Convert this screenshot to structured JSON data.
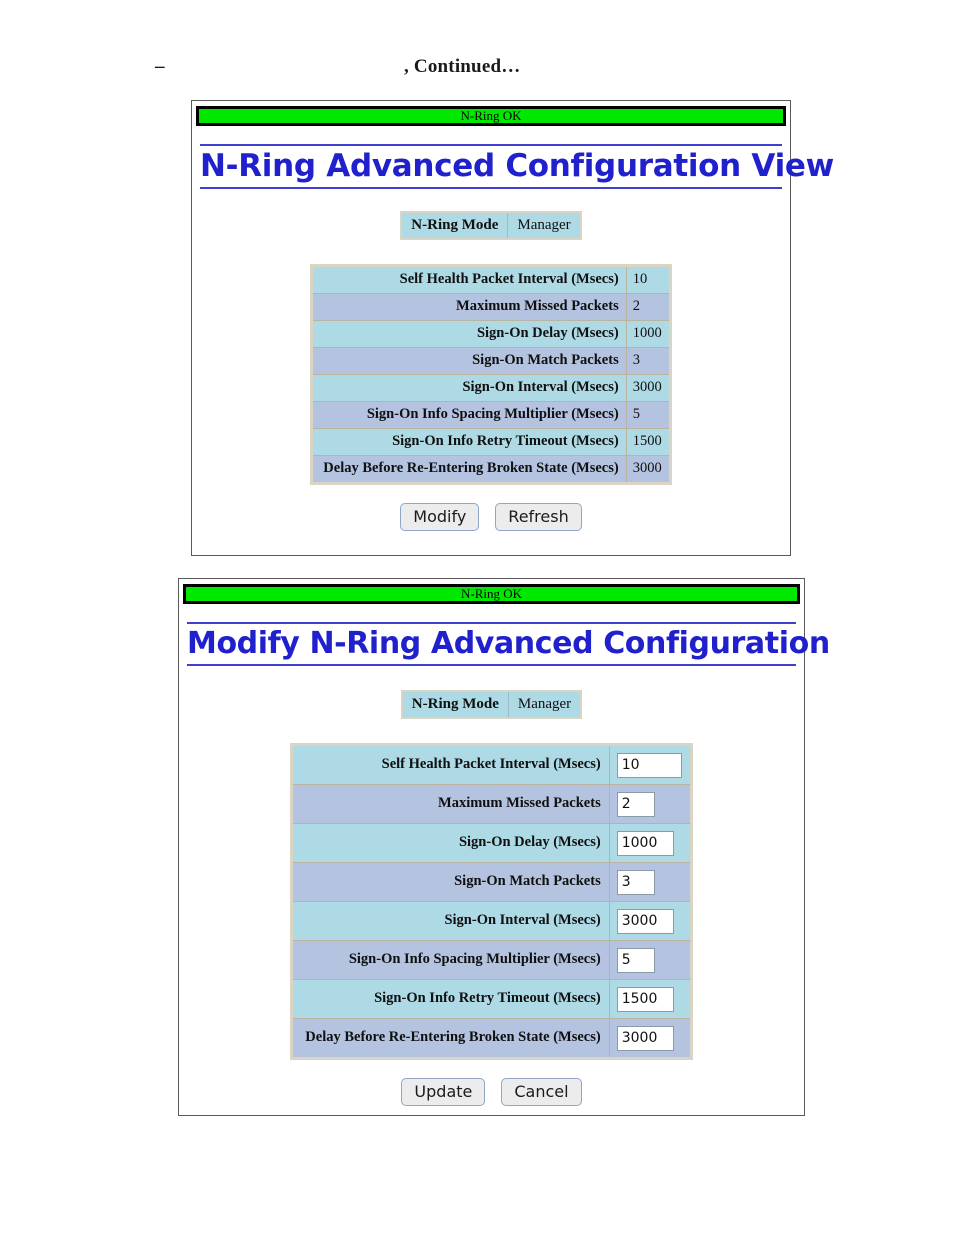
{
  "document_header": {
    "dash": "–",
    "continued": ", Continued…"
  },
  "colors": {
    "status_green": "#00e800",
    "heading_blue": "#2020cc",
    "row_odd": "#aedae6",
    "row_even": "#b4c3df",
    "table_border": "#d9d4c3"
  },
  "view_panel": {
    "status_text": "N-Ring OK",
    "heading": "N-Ring Advanced Configuration View",
    "mode": {
      "label": "N-Ring Mode",
      "value": "Manager"
    },
    "rows": [
      {
        "label": "Self Health Packet Interval (Msecs)",
        "value": "10"
      },
      {
        "label": "Maximum Missed Packets",
        "value": "2"
      },
      {
        "label": "Sign-On Delay (Msecs)",
        "value": "1000"
      },
      {
        "label": "Sign-On Match Packets",
        "value": "3"
      },
      {
        "label": "Sign-On Interval (Msecs)",
        "value": "3000"
      },
      {
        "label": "Sign-On Info Spacing Multiplier (Msecs)",
        "value": "5"
      },
      {
        "label": "Sign-On Info Retry Timeout (Msecs)",
        "value": "1500"
      },
      {
        "label": "Delay Before Re-Entering Broken State (Msecs)",
        "value": "3000"
      }
    ],
    "buttons": {
      "primary": "Modify",
      "secondary": "Refresh"
    }
  },
  "modify_panel": {
    "status_text": "N-Ring OK",
    "heading": "Modify N-Ring Advanced Configuration",
    "mode": {
      "label": "N-Ring Mode",
      "value": "Manager"
    },
    "rows": [
      {
        "label": "Self Health Packet Interval (Msecs)",
        "value": "10"
      },
      {
        "label": "Maximum Missed Packets",
        "value": "2"
      },
      {
        "label": "Sign-On Delay (Msecs)",
        "value": "1000"
      },
      {
        "label": "Sign-On Match Packets",
        "value": "3"
      },
      {
        "label": "Sign-On Interval (Msecs)",
        "value": "3000"
      },
      {
        "label": "Sign-On Info Spacing Multiplier (Msecs)",
        "value": "5"
      },
      {
        "label": "Sign-On Info Retry Timeout (Msecs)",
        "value": "1500"
      },
      {
        "label": "Delay Before Re-Entering Broken State (Msecs)",
        "value": "3000"
      }
    ],
    "buttons": {
      "primary": "Update",
      "secondary": "Cancel"
    }
  }
}
